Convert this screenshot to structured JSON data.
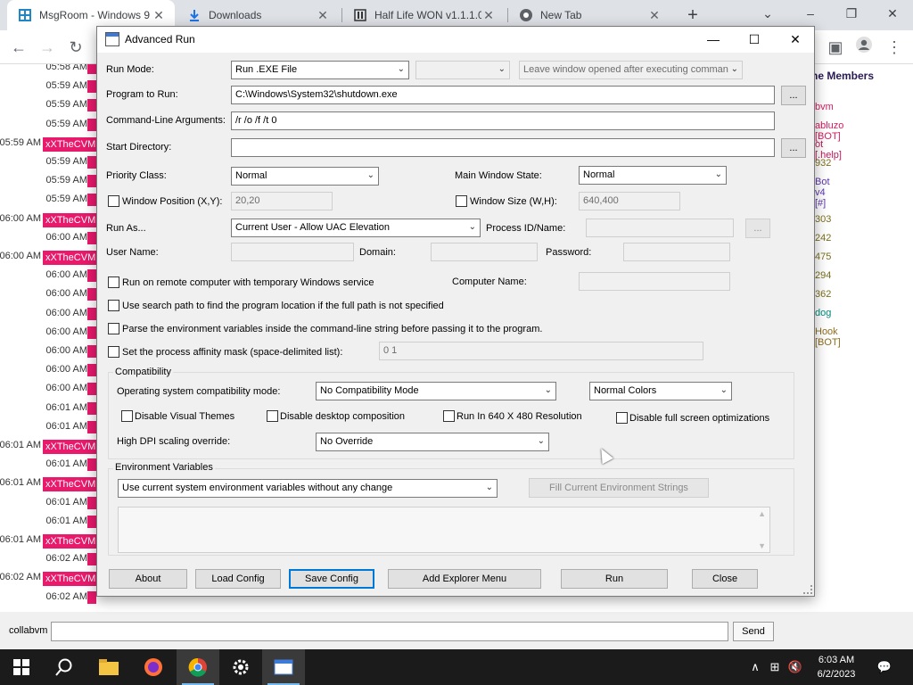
{
  "browser": {
    "tabs": [
      {
        "label": "MsgRoom - Windows 9",
        "icon": "windows-logo-icon",
        "active": true
      },
      {
        "label": "Downloads",
        "icon": "download-icon",
        "active": false
      },
      {
        "label": "Half Life WON v1.1.1.0",
        "icon": "archive-icon",
        "active": false
      },
      {
        "label": "New Tab",
        "icon": "chrome-icon",
        "active": false
      }
    ],
    "new_tab": "+",
    "min": "⌄",
    "window_min": "–",
    "window_restore": "❐",
    "window_close": "✕"
  },
  "chat": {
    "rows": [
      {
        "time": "05:58 AM",
        "user": ""
      },
      {
        "time": "05:59 AM",
        "user": ""
      },
      {
        "time": "05:59 AM",
        "user": ""
      },
      {
        "time": "05:59 AM",
        "user": ""
      },
      {
        "time": "05:59 AM",
        "user": "xXTheCVM"
      },
      {
        "time": "05:59 AM",
        "user": ""
      },
      {
        "time": "05:59 AM",
        "user": ""
      },
      {
        "time": "05:59 AM",
        "user": ""
      },
      {
        "time": "06:00 AM",
        "user": "xXTheCVM"
      },
      {
        "time": "06:00 AM",
        "user": ""
      },
      {
        "time": "06:00 AM",
        "user": "xXTheCVM"
      },
      {
        "time": "06:00 AM",
        "user": ""
      },
      {
        "time": "06:00 AM",
        "user": ""
      },
      {
        "time": "06:00 AM",
        "user": ""
      },
      {
        "time": "06:00 AM",
        "user": ""
      },
      {
        "time": "06:00 AM",
        "user": ""
      },
      {
        "time": "06:00 AM",
        "user": ""
      },
      {
        "time": "06:00 AM",
        "user": ""
      },
      {
        "time": "06:01 AM",
        "user": ""
      },
      {
        "time": "06:01 AM",
        "user": ""
      },
      {
        "time": "06:01 AM",
        "user": "xXTheCVM"
      },
      {
        "time": "06:01 AM",
        "user": ""
      },
      {
        "time": "06:01 AM",
        "user": "xXTheCVM"
      },
      {
        "time": "06:01 AM",
        "user": ""
      },
      {
        "time": "06:01 AM",
        "user": ""
      },
      {
        "time": "06:01 AM",
        "user": "xXTheCVM"
      },
      {
        "time": "06:02 AM",
        "user": ""
      },
      {
        "time": "06:02 AM",
        "user": "xXTheCVM"
      },
      {
        "time": "06:02 AM",
        "user": ""
      }
    ],
    "members_title": "ne Members",
    "members": [
      {
        "name": "bvm",
        "color": "#d81b60"
      },
      {
        "name": "abluzo [BOT]",
        "color": "#d81b60"
      },
      {
        "name": "ot [.help]",
        "color": "#c2185b"
      },
      {
        "name": "932",
        "color": "#7a6f1c"
      },
      {
        "name": "Bot v4 [#]",
        "color": "#5e35b1"
      },
      {
        "name": "303",
        "color": "#7a6f1c"
      },
      {
        "name": "242",
        "color": "#7a6f1c"
      },
      {
        "name": "475",
        "color": "#7a6f1c"
      },
      {
        "name": "294",
        "color": "#7a6f1c"
      },
      {
        "name": "362",
        "color": "#7a6f1c"
      },
      {
        "name": "dog",
        "color": "#00897b"
      },
      {
        "name": "Hook [BOT]",
        "color": "#8d6e1c"
      }
    ],
    "username": "collabvm",
    "message": "",
    "send_label": "Send"
  },
  "dialog": {
    "title": "Advanced Run",
    "run_mode_label": "Run Mode:",
    "run_mode_value": "Run .EXE File",
    "run_mode_extra": "",
    "leave_window_value": "Leave window opened after executing comman",
    "program_label": "Program to Run:",
    "program_value": "C:\\Windows\\System32\\shutdown.exe",
    "browse_label": "...",
    "args_label": "Command-Line Arguments:",
    "args_value": "/r /o /f /t 0",
    "startdir_label": "Start Directory:",
    "startdir_value": "",
    "priority_label": "Priority Class:",
    "priority_value": "Normal",
    "mainwin_label": "Main Window State:",
    "mainwin_value": "Normal",
    "winpos_label": "Window Position (X,Y):",
    "winpos_value": "20,20",
    "winsize_label": "Window Size (W,H):",
    "winsize_value": "640,400",
    "runas_label": "Run As...",
    "runas_value": "Current User - Allow UAC Elevation",
    "procid_label": "Process ID/Name:",
    "procid_value": "",
    "username_label": "User Name:",
    "domain_label": "Domain:",
    "password_label": "Password:",
    "remote_label": "Run on remote computer with temporary Windows service",
    "computer_label": "Computer Name:",
    "searchpath_label": "Use search path to find the program location if the full path is not specified",
    "parseenv_label": "Parse the environment variables inside the command-line string before passing it to the program.",
    "affinity_label": "Set the process affinity mask (space-delimited list):",
    "affinity_value": "0 1",
    "compat_group": "Compatibility",
    "compat_mode_label": "Operating system compatibility mode:",
    "compat_mode_value": "No Compatibility Mode",
    "colors_value": "Normal Colors",
    "visual_themes_label": "Disable Visual Themes",
    "desktop_comp_label": "Disable desktop composition",
    "res640_label": "Run In 640 X 480 Resolution",
    "fullscreen_opt_label": "Disable full screen optimizations",
    "dpi_label": "High DPI scaling override:",
    "dpi_value": "No Override",
    "env_group": "Environment Variables",
    "env_mode_value": "Use current system environment variables without any change",
    "fill_env_label": "Fill Current Environment Strings",
    "buttons": {
      "about": "About",
      "load": "Load Config",
      "save": "Save Config",
      "explorer": "Add Explorer Menu",
      "run": "Run",
      "close": "Close"
    }
  },
  "taskbar": {
    "time": "6:03 AM",
    "date": "6/2/2023"
  }
}
